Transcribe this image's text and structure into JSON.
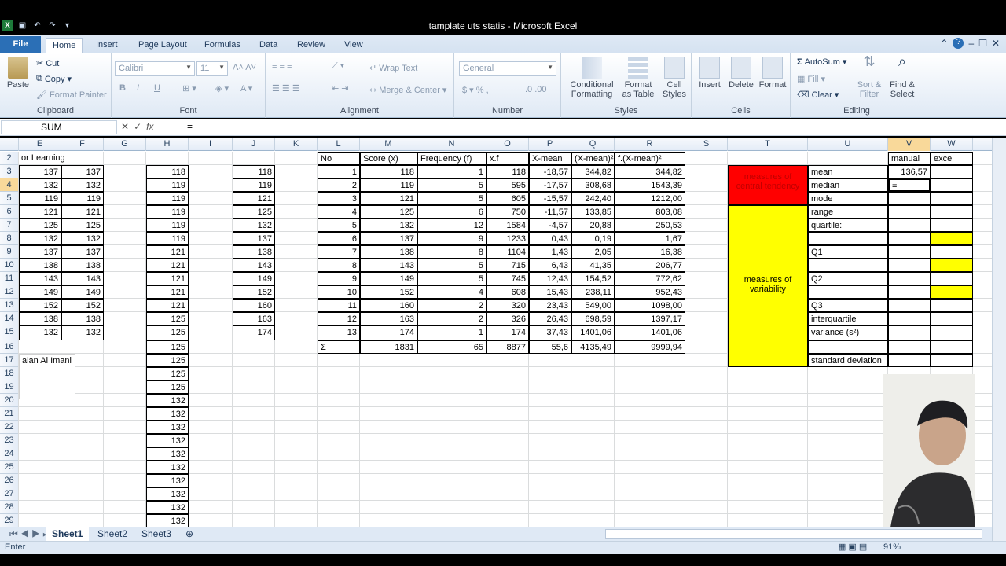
{
  "app": {
    "title": "tamplate uts statis  -  Microsoft Excel",
    "tabs": [
      "File",
      "Home",
      "Insert",
      "Page Layout",
      "Formulas",
      "Data",
      "Review",
      "View"
    ]
  },
  "ribbon": {
    "clipboard": {
      "label": "Clipboard",
      "paste": "Paste",
      "cut": "Cut",
      "copy": "Copy",
      "format_painter": "Format Painter"
    },
    "font": {
      "label": "Font",
      "name": "Calibri",
      "size": "11",
      "bold": "B",
      "italic": "I",
      "underline": "U"
    },
    "alignment": {
      "label": "Alignment",
      "wrap": "Wrap Text",
      "merge": "Merge & Center"
    },
    "number": {
      "label": "Number",
      "format": "General"
    },
    "styles": {
      "label": "Styles",
      "conditional": "Conditional Formatting",
      "format_table": "Format as Table",
      "cell_styles": "Cell Styles"
    },
    "cells": {
      "label": "Cells",
      "insert": "Insert",
      "delete": "Delete",
      "format": "Format"
    },
    "editing": {
      "label": "Editing",
      "autosum": "AutoSum",
      "fill": "Fill",
      "clear": "Clear",
      "sort": "Sort & Filter",
      "find": "Find & Select"
    }
  },
  "formula_bar": {
    "name_box": "SUM",
    "content": "="
  },
  "columns": [
    "E",
    "F",
    "G",
    "H",
    "I",
    "J",
    "K",
    "L",
    "M",
    "N",
    "O",
    "P",
    "Q",
    "R",
    "S",
    "T",
    "U",
    "V",
    "W"
  ],
  "rows": [
    "2",
    "3",
    "4",
    "5",
    "6",
    "7",
    "8",
    "9",
    "10",
    "11",
    "12",
    "13",
    "14",
    "15",
    "16",
    "17",
    "18",
    "19",
    "20",
    "21",
    "22",
    "23",
    "24",
    "25",
    "26",
    "27",
    "28",
    "29"
  ],
  "sheet": {
    "e2_text": "or Learning",
    "colE": [
      "137",
      "132",
      "119",
      "121",
      "125",
      "132",
      "137",
      "138",
      "143",
      "149",
      "152",
      "138",
      "132"
    ],
    "colF": [
      "137",
      "132",
      "119",
      "121",
      "125",
      "132",
      "137",
      "138",
      "143",
      "149",
      "152",
      "138",
      "132"
    ],
    "colH": [
      "118",
      "119",
      "119",
      "119",
      "119",
      "119",
      "121",
      "121",
      "121",
      "121",
      "121",
      "125",
      "125",
      "125",
      "125",
      "125",
      "125",
      "132",
      "132",
      "132",
      "132",
      "132",
      "132",
      "132",
      "132",
      "132",
      "132"
    ],
    "colJ": [
      "118",
      "119",
      "121",
      "125",
      "132",
      "137",
      "138",
      "143",
      "149",
      "152",
      "160",
      "163",
      "174"
    ],
    "textbox": "alan Al Imani",
    "freq_table": {
      "headers": [
        "No",
        "Score (x)",
        "Frequency (f)",
        "x.f",
        "X-mean",
        "(X-mean)²",
        "f.(X-mean)²"
      ],
      "rows": [
        [
          "1",
          "118",
          "1",
          "118",
          "-18,57",
          "344,82",
          "344,82"
        ],
        [
          "2",
          "119",
          "5",
          "595",
          "-17,57",
          "308,68",
          "1543,39"
        ],
        [
          "3",
          "121",
          "5",
          "605",
          "-15,57",
          "242,40",
          "1212,00"
        ],
        [
          "4",
          "125",
          "6",
          "750",
          "-11,57",
          "133,85",
          "803,08"
        ],
        [
          "5",
          "132",
          "12",
          "1584",
          "-4,57",
          "20,88",
          "250,53"
        ],
        [
          "6",
          "137",
          "9",
          "1233",
          "0,43",
          "0,19",
          "1,67"
        ],
        [
          "7",
          "138",
          "8",
          "1104",
          "1,43",
          "2,05",
          "16,38"
        ],
        [
          "8",
          "143",
          "5",
          "715",
          "6,43",
          "41,35",
          "206,77"
        ],
        [
          "9",
          "149",
          "5",
          "745",
          "12,43",
          "154,52",
          "772,62"
        ],
        [
          "10",
          "152",
          "4",
          "608",
          "15,43",
          "238,11",
          "952,43"
        ],
        [
          "11",
          "160",
          "2",
          "320",
          "23,43",
          "549,00",
          "1098,00"
        ],
        [
          "12",
          "163",
          "2",
          "326",
          "26,43",
          "698,59",
          "1397,17"
        ],
        [
          "13",
          "174",
          "1",
          "174",
          "37,43",
          "1401,06",
          "1401,06"
        ]
      ],
      "totals": [
        "Σ",
        "1831",
        "65",
        "8877",
        "55,6",
        "4135,49",
        "9999,94"
      ]
    },
    "measures": {
      "central": "measures of central tendency",
      "variability": "measures of variability",
      "manual": "manual",
      "excel": "excel",
      "labels": [
        "mean",
        "median",
        "mode",
        "range",
        "quartile:",
        "",
        "Q1",
        "",
        "Q2",
        "",
        "Q3",
        "interquartile",
        "variance (s²)",
        "",
        "standard deviation"
      ],
      "mean_manual": "136,57",
      "median_manual": "="
    }
  },
  "sheet_tabs": [
    "Sheet1",
    "Sheet2",
    "Sheet3"
  ],
  "status": {
    "mode": "Enter",
    "zoom": "91%"
  },
  "colors": {
    "red": "#ff0000",
    "yellow": "#ffff00",
    "selected_header": "#f9d99a"
  }
}
